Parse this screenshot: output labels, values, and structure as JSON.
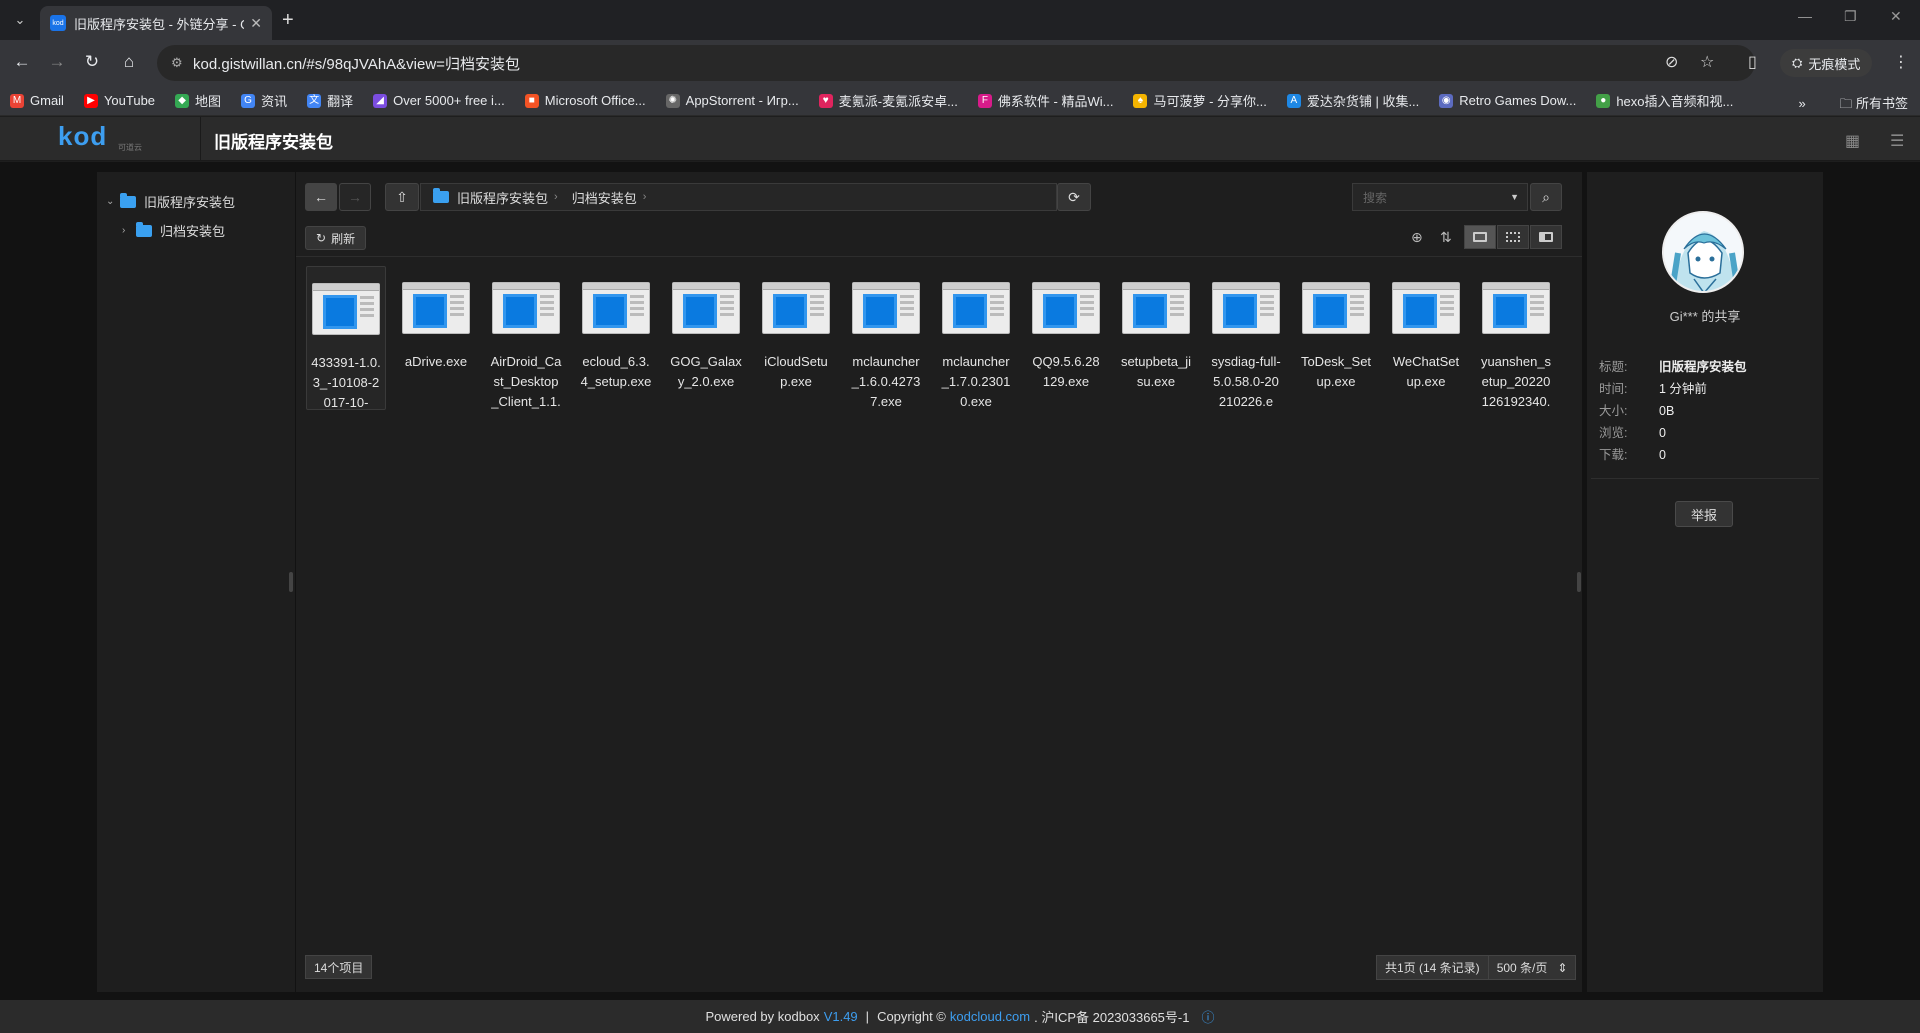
{
  "browser": {
    "tab_title": "旧版程序安装包 - 外链分享 - G",
    "url": "kod.gistwillan.cn/#s/98qJVAhA&view=归档安装包",
    "incognito_label": "无痕模式",
    "bookmarks": [
      {
        "label": "Gmail",
        "color": "#ea4335",
        "glyph": "M"
      },
      {
        "label": "YouTube",
        "color": "#ff0000",
        "glyph": "▶"
      },
      {
        "label": "地图",
        "color": "#34a853",
        "glyph": "◆"
      },
      {
        "label": "资讯",
        "color": "#4285f4",
        "glyph": "G"
      },
      {
        "label": "翻译",
        "color": "#4285f4",
        "glyph": "文"
      },
      {
        "label": "Over 5000+ free i...",
        "color": "#7b4de0",
        "glyph": "◢"
      },
      {
        "label": "Microsoft Office...",
        "color": "#f35325",
        "glyph": "■"
      },
      {
        "label": "AppStorrent - Игр...",
        "color": "#666",
        "glyph": "✺"
      },
      {
        "label": "麦氪派-麦氪派安卓...",
        "color": "#e0245e",
        "glyph": "♥"
      },
      {
        "label": "佛系软件 - 精品Wi...",
        "color": "#d81b8a",
        "glyph": "F"
      },
      {
        "label": "马可菠萝 - 分享你...",
        "color": "#f4b400",
        "glyph": "♠"
      },
      {
        "label": "爱达杂货铺 | 收集...",
        "color": "#1e88e5",
        "glyph": "A"
      },
      {
        "label": "Retro Games Dow...",
        "color": "#5c6bc0",
        "glyph": "◉"
      },
      {
        "label": "hexo插入音频和视...",
        "color": "#43a047",
        "glyph": "●"
      }
    ],
    "all_bookmarks_label": "所有书签"
  },
  "app": {
    "logo": "kod",
    "logo_sub": "可道云",
    "title": "旧版程序安装包"
  },
  "tree": {
    "root": "旧版程序安装包",
    "child": "归档安装包"
  },
  "path": {
    "crumbs": [
      "旧版程序安装包",
      "归档安装包"
    ],
    "search_placeholder": "搜索"
  },
  "toolbar": {
    "refresh_label": "刷新"
  },
  "files": [
    {
      "name": "433391-1.0.3_-10108-2017-10-"
    },
    {
      "name": "aDrive.exe"
    },
    {
      "name": "AirDroid_Cast_Desktop_Client_1.1."
    },
    {
      "name": "ecloud_6.3.4_setup.exe"
    },
    {
      "name": "GOG_Galaxy_2.0.exe"
    },
    {
      "name": "iCloudSetup.exe"
    },
    {
      "name": "mclauncher_1.6.0.42737.exe"
    },
    {
      "name": "mclauncher_1.7.0.23010.exe"
    },
    {
      "name": "QQ9.5.6.28129.exe"
    },
    {
      "name": "setupbeta_jisu.exe"
    },
    {
      "name": "sysdiag-full-5.0.58.0-20210226.e"
    },
    {
      "name": "ToDesk_Setup.exe"
    },
    {
      "name": "WeChatSetup.exe"
    },
    {
      "name": "yuanshen_setup_20220126192340."
    }
  ],
  "status": {
    "count": "14个项目",
    "pages": "共1页 (14 条记录)",
    "per_page": "500 条/页"
  },
  "share": {
    "owner": "Gi*** 的共享",
    "info": [
      {
        "k": "标题:",
        "v": "旧版程序安装包",
        "bold": true
      },
      {
        "k": "时间:",
        "v": "1 分钟前"
      },
      {
        "k": "大小:",
        "v": "0B"
      },
      {
        "k": "浏览:",
        "v": "0"
      },
      {
        "k": "下载:",
        "v": "0"
      }
    ],
    "report_label": "举报"
  },
  "footer": {
    "powered": "Powered by kodbox",
    "version": "V1.49",
    "sep": "|",
    "copyright": "Copyright ©",
    "site": "kodcloud.com",
    "icp": ". 沪ICP备 2023033665号-1"
  }
}
